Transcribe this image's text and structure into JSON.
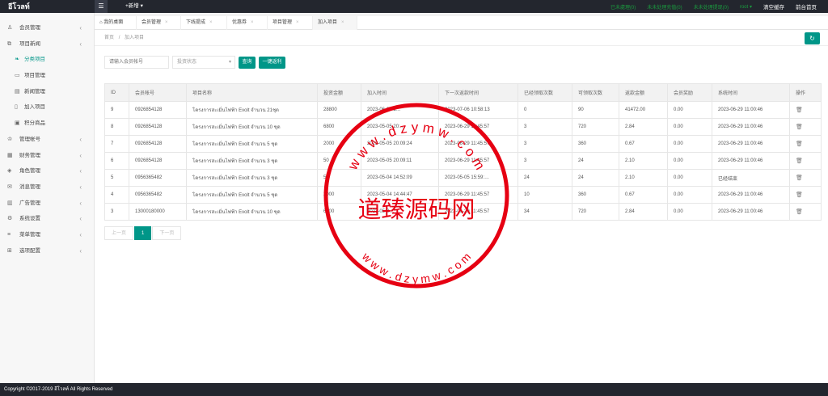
{
  "app": {
    "logo": "อีโวลท์",
    "menu_toggle_icon": "hamburger-icon",
    "new_menu": "+新增",
    "stats": [
      "已未處理(0)",
      "未未处理充值(0)",
      "未未处理提现(0)"
    ],
    "user": "root",
    "clear_cache": "清空缓存",
    "front_home": "前台首页"
  },
  "sidebar": {
    "items": [
      {
        "label": "会员管理",
        "icon": "user-icon",
        "chevron": "‹"
      },
      {
        "label": "项目新闻",
        "icon": "layers-icon",
        "chevron": "‹"
      },
      {
        "label": "分类项目",
        "icon": "tag-icon",
        "chevron": ""
      },
      {
        "label": "项目管理",
        "icon": "folder-icon",
        "chevron": ""
      },
      {
        "label": "新闻管理",
        "icon": "news-icon",
        "chevron": ""
      },
      {
        "label": "加入项目",
        "icon": "file-icon",
        "chevron": ""
      },
      {
        "label": "积分商品",
        "icon": "gift-icon",
        "chevron": ""
      },
      {
        "label": "管理帐号",
        "icon": "admin-icon",
        "chevron": "‹"
      },
      {
        "label": "财务管理",
        "icon": "finance-icon",
        "chevron": "‹"
      },
      {
        "label": "角色管理",
        "icon": "role-icon",
        "chevron": "‹"
      },
      {
        "label": "消息管理",
        "icon": "message-icon",
        "chevron": "‹"
      },
      {
        "label": "广告管理",
        "icon": "ad-icon",
        "chevron": "‹"
      },
      {
        "label": "系统设置",
        "icon": "settings-icon",
        "chevron": "‹"
      },
      {
        "label": "菜单管理",
        "icon": "menu-icon",
        "chevron": "‹"
      },
      {
        "label": "选项配置",
        "icon": "config-icon",
        "chevron": "‹"
      }
    ]
  },
  "tabs": [
    {
      "label": "我的桌面",
      "icon": "home-icon"
    },
    {
      "label": "会员管理"
    },
    {
      "label": "下线提成"
    },
    {
      "label": "优惠券"
    },
    {
      "label": "项目管理"
    },
    {
      "label": "加入项目"
    }
  ],
  "tab_close": "×",
  "breadcrumb": {
    "home": "首页",
    "sep": "/",
    "current": "加入项目"
  },
  "refresh_icon": "refresh-icon",
  "filter": {
    "search_placeholder": "请输入会员帐号",
    "status_placeholder": "投资状态",
    "query_label": "查询",
    "settle_label": "一键返利"
  },
  "table": {
    "headers": [
      "ID",
      "会员帐号",
      "项目名称",
      "投资金额",
      "加入时间",
      "下一次返款时间",
      "已经领取次数",
      "可领取次数",
      "返款金额",
      "会员奖励",
      "系统时间",
      "操作"
    ],
    "rows": [
      [
        "9",
        "0926854128",
        "โครงการสะเมิ่นไฟฟ้า Evolt จำนวน 21ชุด",
        "28800",
        "2023-06-29 1…",
        "2023-07-06 10:58:13",
        "0",
        "90",
        "41472.00",
        "0.00",
        "2023-06-29 11:00:46"
      ],
      [
        "8",
        "0926854128",
        "โครงการสะเมิ่นไฟฟ้า Evolt จำนวน 10 ชุด",
        "6800",
        "2023-05-05 20:…",
        "2023-06-29 11:45:57",
        "3",
        "720",
        "2.84",
        "0.00",
        "2023-06-29 11:00:46"
      ],
      [
        "7",
        "0926854128",
        "โครงการสะเมิ่นไฟฟ้า Evolt จำนวน 5 ชุด",
        "2000",
        "2023-05-05 20:09:24",
        "2023-06-29 11:45:57",
        "3",
        "360",
        "0.67",
        "0.00",
        "2023-06-29 11:00:46"
      ],
      [
        "6",
        "0926854128",
        "โครงการสะเมิ่นไฟฟ้า Evolt จำนวน 3 ชุด",
        "50",
        "2023-05-05 20:09:11",
        "2023-06-29 11:45:57",
        "3",
        "24",
        "2.10",
        "0.00",
        "2023-06-29 11:00:46"
      ],
      [
        "5",
        "0956365482",
        "โครงการสะเมิ่นไฟฟ้า Evolt จำนวน 3 ชุด",
        "50",
        "2023-05-04 14:52:09",
        "2023-05-05 15:59:…",
        "24",
        "24",
        "2.10",
        "0.00",
        "已经结束"
      ],
      [
        "4",
        "0956365482",
        "โครงการสะเมิ่นไฟฟ้า Evolt จำนวน 5 ชุด",
        "2000",
        "2023-05-04 14:44:47",
        "2023-06-29 11:45:57",
        "10",
        "360",
        "0.67",
        "0.00",
        "2023-06-29 11:00:46"
      ],
      [
        "3",
        "13000180000",
        "โครงการสะเมิ่นไฟฟ้า Evolt จำนวน 10 ชุด",
        "6800",
        "2023-05-0…",
        "2023-06-29 11:45:57",
        "34",
        "720",
        "2.84",
        "0.00",
        "2023-06-29 11:00:46"
      ]
    ],
    "action_icon": "trash-icon"
  },
  "pagination": {
    "prev": "上一页",
    "current": "1",
    "next": "下一页"
  },
  "footer": "Copyright ©2017-2019 อีโวลท์ All Rights Reserved",
  "watermark": {
    "top_text": "w w w . d z y m w . c o m",
    "center_text": "道臻源码网",
    "bottom_text": "w w w . d z y m w . c o m",
    "color": "#e60012"
  }
}
